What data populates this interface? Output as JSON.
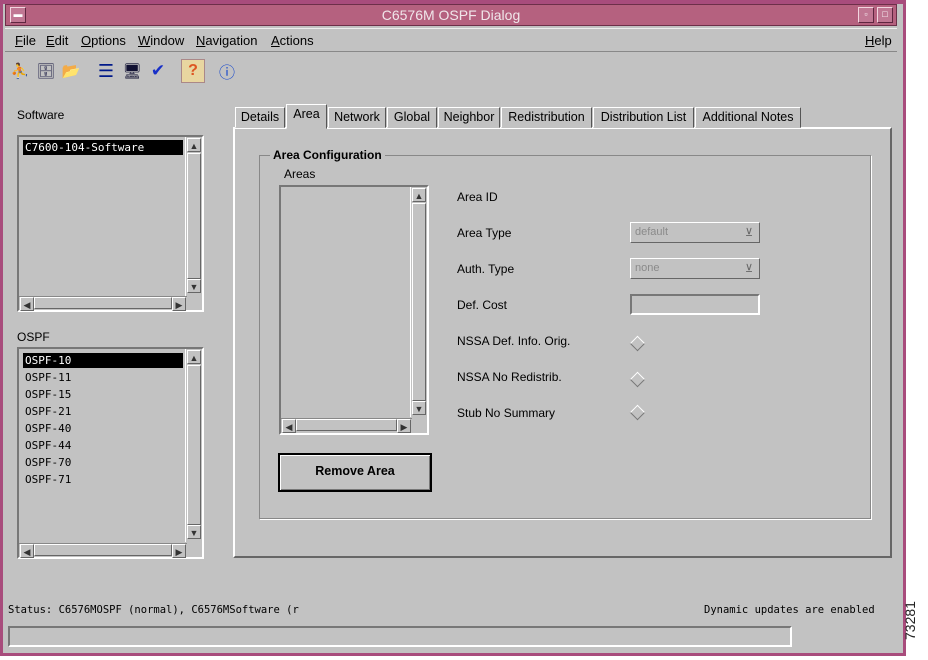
{
  "window": {
    "title": "C6576M OSPF Dialog",
    "accent_color": "#b5617f",
    "buttons": [
      "window-menu",
      "minimize",
      "maximize"
    ]
  },
  "menubar": {
    "items": [
      {
        "label": "File",
        "accel": "F",
        "rest": "ile"
      },
      {
        "label": "Edit",
        "accel": "E",
        "rest": "dit"
      },
      {
        "label": "Options",
        "accel": "O",
        "rest": "ptions"
      },
      {
        "label": "Window",
        "accel": "W",
        "rest": "indow"
      },
      {
        "label": "Navigation",
        "accel": "N",
        "rest": "avigation"
      },
      {
        "label": "Actions",
        "accel": "A",
        "rest": "ctions"
      }
    ],
    "help": {
      "label": "Help",
      "accel": "H",
      "rest": "elp"
    }
  },
  "toolbar": {
    "icons": [
      "tree-icon",
      "database-icon",
      "folder-open-icon",
      "list-icon",
      "monitor-icon",
      "check-icon",
      "help-question-icon",
      "info-icon"
    ],
    "glyphs": [
      "⛹",
      "🗄",
      "📂",
      "☰",
      "🖥",
      "✔",
      "?",
      "ⓘ"
    ]
  },
  "software": {
    "label": "Software",
    "items": [
      "C7600-104-Software"
    ],
    "selected": 0
  },
  "ospf": {
    "label": "OSPF",
    "items": [
      "OSPF-10",
      "OSPF-11",
      "OSPF-15",
      "OSPF-21",
      "OSPF-40",
      "OSPF-44",
      "OSPF-70",
      "OSPF-71"
    ],
    "selected": 0
  },
  "tabs": {
    "items": [
      "Details",
      "Area",
      "Network",
      "Global",
      "Neighbor",
      "Redistribution",
      "Distribution List",
      "Additional Notes"
    ],
    "active": 1
  },
  "area_config": {
    "group_title": "Area Configuration",
    "areas_label": "Areas",
    "areas": [],
    "fields": {
      "area_id": {
        "label": "Area ID"
      },
      "area_type": {
        "label": "Area Type",
        "value": "default"
      },
      "auth_type": {
        "label": "Auth. Type",
        "value": "none"
      },
      "def_cost": {
        "label": "Def. Cost",
        "value": ""
      },
      "nssa_def_info_orig": {
        "label": "NSSA Def. Info. Orig.",
        "checked": false
      },
      "nssa_no_redistrib": {
        "label": "NSSA No Redistrib.",
        "checked": false
      },
      "stub_no_summary": {
        "label": "Stub No Summary",
        "checked": false
      }
    },
    "remove_button": "Remove Area"
  },
  "status": {
    "left": "Status: C6576MOSPF (normal), C6576MSoftware (r",
    "right": "Dynamic updates are enabled"
  },
  "figure_id": "73281"
}
